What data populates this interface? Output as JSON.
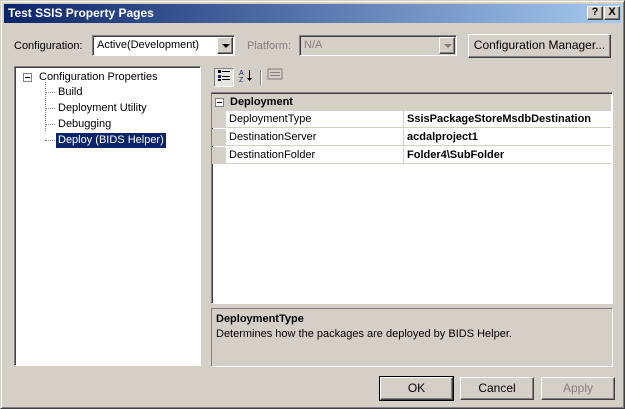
{
  "window": {
    "title": "Test SSIS Property Pages",
    "help_button": "?",
    "close_button": "X"
  },
  "config_bar": {
    "configuration_label": "Configuration:",
    "configuration_value": "Active(Development)",
    "platform_label": "Platform:",
    "platform_value": "N/A",
    "manager_button": "Configuration Manager..."
  },
  "tree": {
    "root": "Configuration Properties",
    "items": [
      {
        "label": "Build",
        "selected": false
      },
      {
        "label": "Deployment Utility",
        "selected": false
      },
      {
        "label": "Debugging",
        "selected": false
      },
      {
        "label": "Deploy (BIDS Helper)",
        "selected": true
      }
    ]
  },
  "toolbar": {
    "icons": [
      "categorized-icon",
      "alphabetical-icon",
      "property-pages-icon"
    ]
  },
  "grid": {
    "category": "Deployment",
    "properties": [
      {
        "name": "DeploymentType",
        "value": "SsisPackageStoreMsdbDestination"
      },
      {
        "name": "DestinationServer",
        "value": "acdalproject1"
      },
      {
        "name": "DestinationFolder",
        "value": "Folder4\\SubFolder"
      }
    ]
  },
  "description": {
    "title": "DeploymentType",
    "text": "Determines how the packages are deployed by BIDS Helper."
  },
  "buttons": {
    "ok": "OK",
    "cancel": "Cancel",
    "apply": "Apply"
  }
}
